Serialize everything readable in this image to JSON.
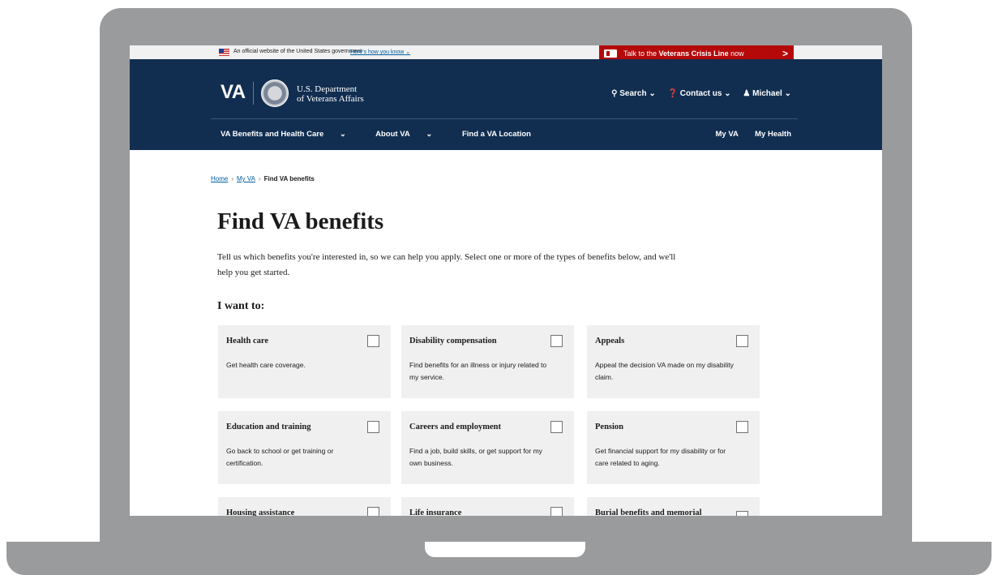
{
  "gov_banner": {
    "text": "An official website of the United States government",
    "link": "Here's how you know"
  },
  "crisis_line": {
    "prefix": "Talk to the",
    "bold": "Veterans Crisis Line",
    "suffix": "now",
    "chevron": ">"
  },
  "header": {
    "logo": "VA",
    "department_line1": "U.S. Department",
    "department_line2": "of Veterans Affairs",
    "search": "Search",
    "contact": "Contact us",
    "user": "Michael"
  },
  "nav": {
    "left": [
      "VA Benefits and Health Care",
      "About VA",
      "Find a VA Location"
    ],
    "right": [
      "My VA",
      "My Health"
    ]
  },
  "breadcrumb": [
    "Home",
    "My VA",
    "Find VA benefits"
  ],
  "page": {
    "title": "Find VA benefits",
    "intro": "Tell us which benefits you're interested in, so we can help you apply. Select one or more of the types of benefits below, and we'll help you get started.",
    "want": "I want to:"
  },
  "cards": [
    {
      "title": "Health care",
      "desc": "Get health care coverage."
    },
    {
      "title": "Disability compensation",
      "desc": "Find benefits for an illness or injury related to my service."
    },
    {
      "title": "Appeals",
      "desc": "Appeal the decision VA made on my disability claim."
    },
    {
      "title": "Education and training",
      "desc": "Go back to school or get training or certification."
    },
    {
      "title": "Careers and employment",
      "desc": "Find a job, build skills, or get support for my own business."
    },
    {
      "title": "Pension",
      "desc": "Get financial support for my disability or for care related to aging."
    },
    {
      "title": "Housing assistance",
      "desc": ""
    },
    {
      "title": "Life insurance",
      "desc": ""
    },
    {
      "title": "Burial benefits and memorial",
      "desc": ""
    }
  ],
  "colors": {
    "header_bg": "#112e51",
    "crisis_bg": "#b50909",
    "link": "#005ea2",
    "card_bg": "#f0f0f0"
  }
}
